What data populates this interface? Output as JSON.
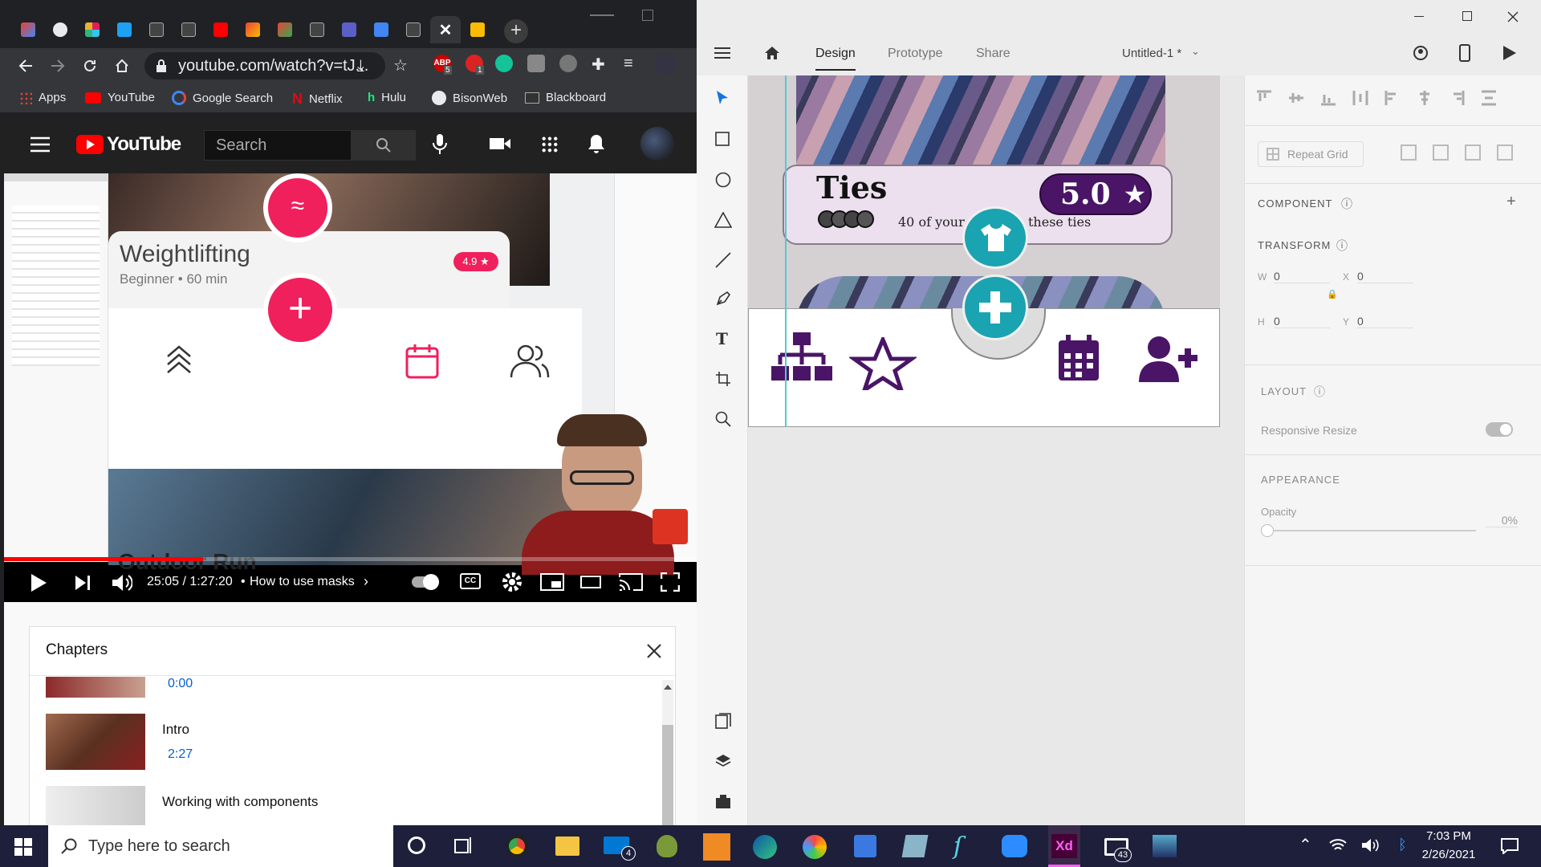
{
  "browser": {
    "url": "youtube.com/watch?v=tJ...",
    "bookmarks": [
      "Apps",
      "YouTube",
      "Google Search",
      "Netflix",
      "Hulu",
      "BisonWeb",
      "Blackboard"
    ],
    "ext_badge1": "5",
    "ext_badge2": "1"
  },
  "youtube": {
    "logo": "YouTube",
    "search_placeholder": "Search",
    "video_card_title": "Weightlifting",
    "video_card_sub": "Beginner • 60 min",
    "video_card_rating": "4.9 ★",
    "video_card_next": "Outdoor Run",
    "time": "25:05 / 1:27:20",
    "chapter_now": "How to use masks",
    "chapters_title": "Chapters",
    "chapters": [
      {
        "title": "",
        "time": "0:00"
      },
      {
        "title": "Intro",
        "time": "2:27"
      },
      {
        "title": "Working with components",
        "time": ""
      }
    ]
  },
  "xd": {
    "tabs": [
      "Design",
      "Prototype",
      "Share"
    ],
    "doc_title": "Untitled-1 *",
    "card_title": "Ties",
    "card_text_left": "40 of your f",
    "card_text_right": "these ties",
    "rating": "5.0",
    "repeat_grid": "Repeat Grid",
    "component": "COMPONENT",
    "transform": "TRANSFORM",
    "w_label": "W",
    "w_val": "0",
    "x_label": "X",
    "x_val": "0",
    "h_label": "H",
    "h_val": "0",
    "y_label": "Y",
    "y_val": "0",
    "layout": "LAYOUT",
    "responsive": "Responsive Resize",
    "appearance": "APPEARANCE",
    "opacity_label": "Opacity",
    "opacity_val": "0%",
    "purple": "#4a1566",
    "teal": "#1aa3b0"
  },
  "taskbar": {
    "search_placeholder": "Type here to search",
    "mail_badge": "4",
    "notif_badge": "43",
    "time": "7:03 PM",
    "date": "2/26/2021"
  }
}
